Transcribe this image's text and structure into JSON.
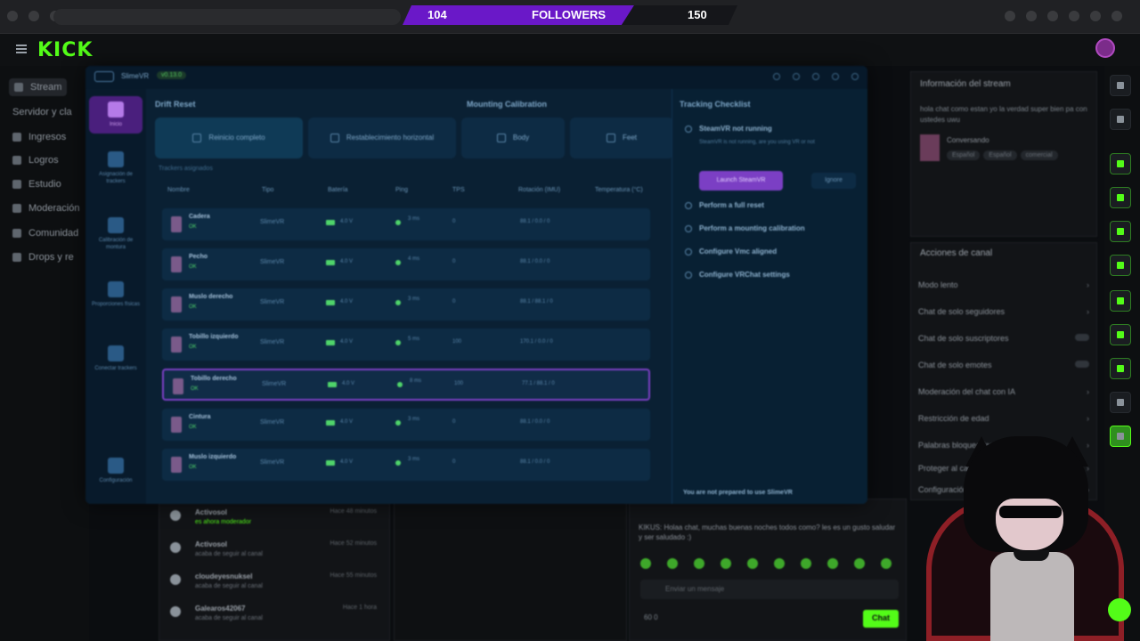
{
  "browser": {
    "url": "",
    "ext_icons": 6
  },
  "overlay": {
    "current_followers": "104",
    "label": "FOLLOWERS",
    "goal_followers": "150"
  },
  "header": {
    "logo": "KICK"
  },
  "left_nav": {
    "items": [
      {
        "label": "Stream",
        "icon": "stream-icon",
        "active": true
      },
      {
        "label": "Servidor y cla",
        "icon": "server-icon",
        "active": false
      },
      {
        "label": "Ingresos",
        "icon": "income-icon",
        "active": false
      },
      {
        "label": "Logros",
        "icon": "trophy-icon",
        "active": false
      },
      {
        "label": "Estudio",
        "icon": "studio-icon",
        "active": false
      },
      {
        "label": "Moderación",
        "icon": "moderation-icon",
        "active": false
      },
      {
        "label": "Comunidad",
        "icon": "community-icon",
        "active": false
      },
      {
        "label": "Drops y re",
        "icon": "drops-icon",
        "active": false
      }
    ]
  },
  "stream_info": {
    "header": "Información del stream",
    "description": "hola chat como estan yo la verdad super bien pa con ustedes uwu",
    "category": "Conversando",
    "tags": [
      "Español",
      "Español",
      "comercial"
    ]
  },
  "channel_actions": {
    "header": "Acciones de canal",
    "rows": [
      {
        "label": "Modo lento",
        "control": "chevron"
      },
      {
        "label": "Chat de solo seguidores",
        "control": "chevron"
      },
      {
        "label": "Chat de solo suscriptores",
        "control": "switch"
      },
      {
        "label": "Chat de solo emotes",
        "control": "switch"
      },
      {
        "label": "Moderación del chat con IA",
        "control": "chevron"
      },
      {
        "label": "Restricción de edad",
        "control": "chevron"
      },
      {
        "label": "Palabras bloqueadas",
        "control": "chevron"
      },
      {
        "label": "Proteger al canal",
        "control": "chevron"
      },
      {
        "label": "Configuración",
        "control": "chevron"
      }
    ]
  },
  "app": {
    "name": "SlimeVR",
    "version": "v0.13.0",
    "sidebar": [
      {
        "label": "Inicio",
        "active": true
      },
      {
        "label": "Asignación de trackers",
        "active": false
      },
      {
        "label": "Calibración de montura",
        "active": false
      },
      {
        "label": "Proporciones físicas",
        "active": false
      },
      {
        "label": "Conectar trackers",
        "active": false
      },
      {
        "label": "Configuración",
        "active": false
      }
    ],
    "sections": {
      "drift": "Drift Reset",
      "mounting": "Mounting Calibration"
    },
    "reset_buttons": [
      {
        "label": "Reinicio completo"
      },
      {
        "label": "Restablecimiento horizontal"
      },
      {
        "label": "Body"
      },
      {
        "label": "Feet"
      }
    ],
    "tracker_group": "Trackers asignados",
    "columns": [
      "Nombre",
      "Tipo",
      "Batería",
      "Ping",
      "TPS",
      "Rotación (IMU)",
      "Temperatura (°C)"
    ],
    "trackers": [
      {
        "name": "Cadera",
        "status": "OK",
        "type": "SlimeVR",
        "battery": "4.0 V",
        "ping": "3 ms",
        "tps": "0",
        "rotation": "88.1 / 0.0 / 0",
        "selected": false
      },
      {
        "name": "Pecho",
        "status": "OK",
        "type": "SlimeVR",
        "battery": "4.0 V",
        "ping": "4 ms",
        "tps": "0",
        "rotation": "88.1 / 0.0 / 0",
        "selected": false
      },
      {
        "name": "Muslo derecho",
        "status": "OK",
        "type": "SlimeVR",
        "battery": "4.0 V",
        "ping": "3 ms",
        "tps": "0",
        "rotation": "88.1 / 88.1 / 0",
        "selected": false
      },
      {
        "name": "Tobillo izquierdo",
        "status": "OK",
        "type": "SlimeVR",
        "battery": "4.0 V",
        "ping": "5 ms",
        "tps": "100",
        "rotation": "170.1 / 0.0 / 0",
        "selected": false
      },
      {
        "name": "Tobillo derecho",
        "status": "OK",
        "type": "SlimeVR",
        "battery": "4.0 V",
        "ping": "8 ms",
        "tps": "100",
        "rotation": "77.1 / 88.1 / 0",
        "selected": true
      },
      {
        "name": "Cintura",
        "status": "OK",
        "type": "SlimeVR",
        "battery": "4.0 V",
        "ping": "3 ms",
        "tps": "0",
        "rotation": "88.1 / 0.0 / 0",
        "selected": false
      },
      {
        "name": "Muslo izquierdo",
        "status": "OK",
        "type": "SlimeVR",
        "battery": "4.0 V",
        "ping": "3 ms",
        "tps": "0",
        "rotation": "88.1 / 0.0 / 0",
        "selected": false
      }
    ],
    "checklist": {
      "title": "Tracking Checklist",
      "steps": [
        {
          "label": "SteamVR not running"
        },
        {
          "label": "Perform a full reset"
        },
        {
          "label": "Perform a mounting calibration"
        },
        {
          "label": "Configure Vmc aligned"
        },
        {
          "label": "Configure VRChat settings"
        }
      ],
      "note": "SteamVR is not running, are you using VR or not",
      "launch_label": "Launch SteamVR",
      "ignore_label": "Ignore",
      "footer": "You are not prepared to use SlimeVR",
      "progress": 0.36
    }
  },
  "activity": [
    {
      "name": "Activosol",
      "sub": "es ahora moderador",
      "time": "Hace 48 minutos",
      "green": true
    },
    {
      "name": "Activosol",
      "sub": "acaba de seguir al canal",
      "time": "Hace 52 minutos",
      "green": false
    },
    {
      "name": "cloudeyesnuksel",
      "sub": "acaba de seguir al canal",
      "time": "Hace 55 minutos",
      "green": false
    },
    {
      "name": "Galearos42067",
      "sub": "acaba de seguir al canal",
      "time": "Hace 1 hora",
      "green": false
    }
  ],
  "chat": {
    "message": "KIKUS: Holaa chat, muchas buenas noches todos como? les es un gusto saludar y ser saludado :)",
    "input_placeholder": "Enviar un mensaje",
    "send_label": "Chat",
    "counts": "60   0"
  }
}
